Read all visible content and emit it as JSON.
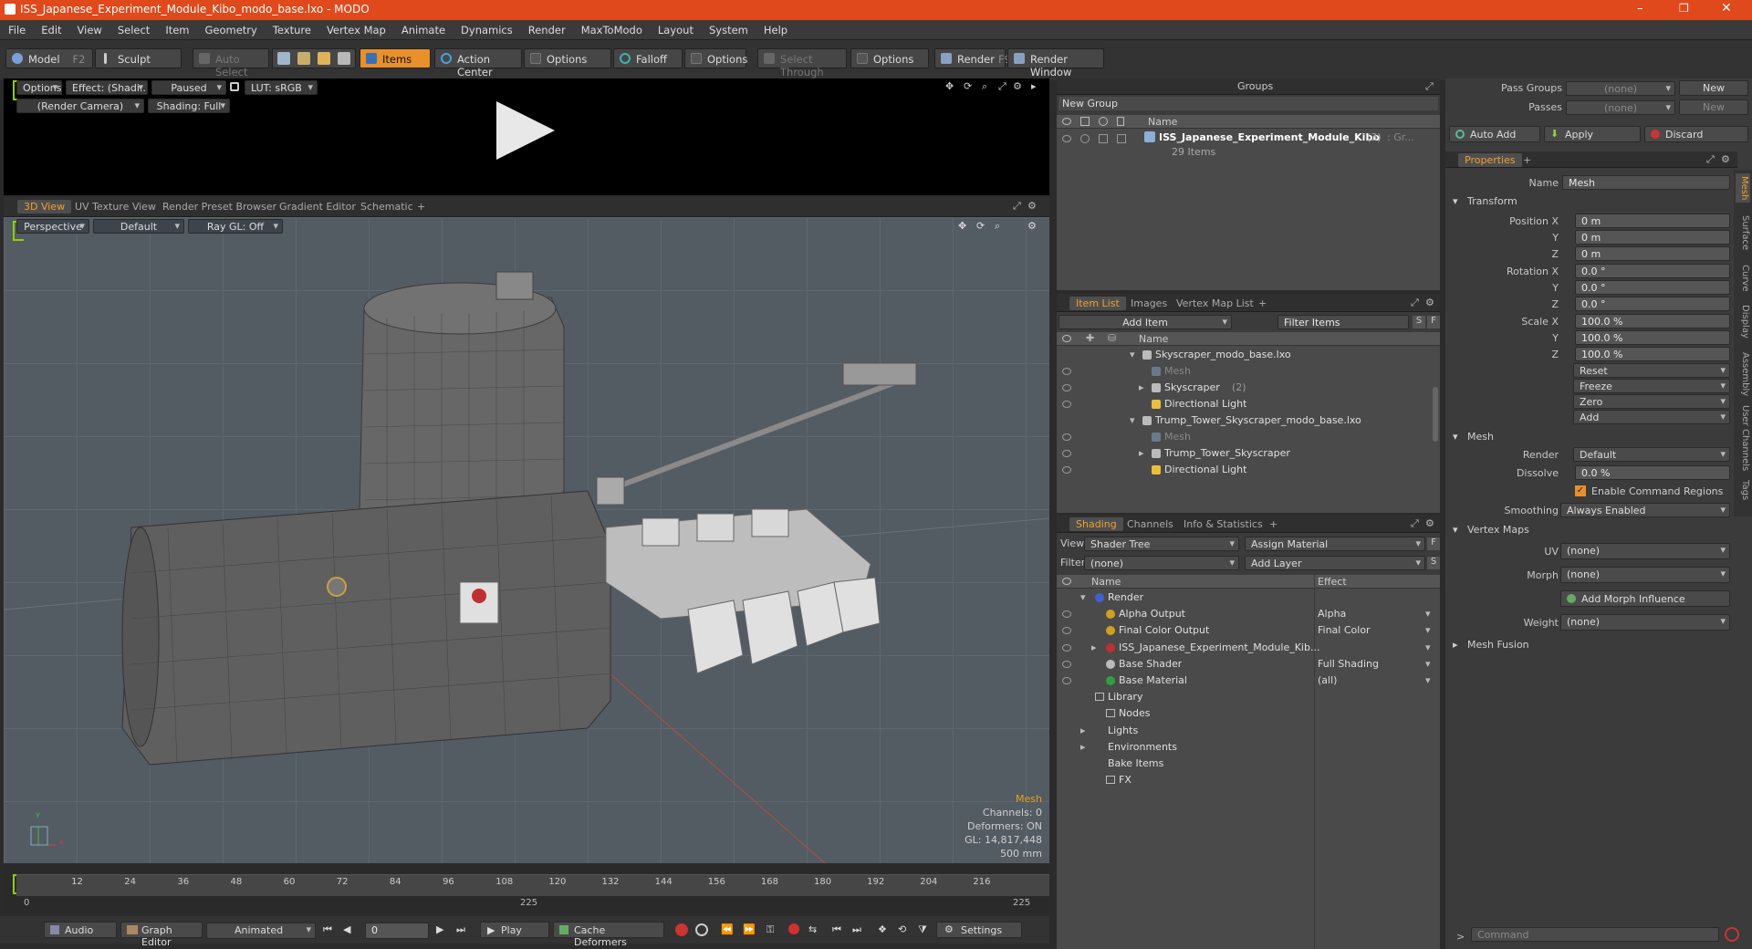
{
  "window": {
    "title": "ISS_Japanese_Experiment_Module_Kibo_modo_base.lxo - MODO"
  },
  "menu": [
    "File",
    "Edit",
    "View",
    "Select",
    "Item",
    "Geometry",
    "Texture",
    "Vertex Map",
    "Animate",
    "Dynamics",
    "Render",
    "MaxToModo",
    "Layout",
    "System",
    "Help"
  ],
  "toolbar": {
    "model": "Model",
    "model_key": "F2",
    "sculpt": "Sculpt",
    "auto_select": "Auto Select",
    "items": "Items",
    "action_center": "Action Center",
    "options1": "Options",
    "falloff": "Falloff",
    "options2": "Options",
    "select_through": "Select Through",
    "options3": "Options",
    "render": "Render",
    "render_key": "F9",
    "render_window": "Render Window"
  },
  "preview": {
    "options": "Options",
    "effect": "Effect: (Shadi...",
    "paused": "Paused",
    "lut": "LUT: sRGB",
    "camera": "(Render Camera)",
    "shading": "Shading: Full"
  },
  "viewport_tabs": [
    "3D View",
    "UV Texture View",
    "Render Preset Browser",
    "Gradient Editor",
    "Schematic"
  ],
  "viewport": {
    "perspective": "Perspective",
    "default": "Default",
    "raygl": "Ray GL: Off",
    "info": {
      "mesh": "Mesh",
      "channels": "Channels: 0",
      "deformers": "Deformers: ON",
      "gl": "GL: 14,817,448",
      "size": "500 mm"
    },
    "label_x": "x",
    "label_y": "y"
  },
  "timeline": {
    "ticks": [
      "0",
      "12",
      "24",
      "36",
      "48",
      "60",
      "72",
      "84",
      "96",
      "108",
      "120",
      "132",
      "144",
      "156",
      "168",
      "180",
      "192",
      "204",
      "216"
    ],
    "mid": "225",
    "end": "225",
    "start": "0"
  },
  "bottombar": {
    "audio": "Audio",
    "graph_editor": "Graph Editor",
    "animated": "Animated",
    "frame": "0",
    "play": "Play",
    "cache": "Cache Deformers",
    "settings": "Settings"
  },
  "groups": {
    "title": "Groups",
    "new_group": "New Group",
    "col_name": "Name",
    "item_name": "ISS_Japanese_Experiment_Module_Kibo",
    "item_count": "(3)",
    "item_suffix": ": Gr...",
    "item_sub": "29 Items"
  },
  "itemlist": {
    "tabs": [
      "Item List",
      "Images",
      "Vertex Map List"
    ],
    "add_item": "Add Item",
    "filter": "Filter Items",
    "col_name": "Name",
    "rows": [
      {
        "label": "Skyscraper_modo_base.lxo",
        "indent": 0,
        "arrow": "▾"
      },
      {
        "label": "Mesh",
        "indent": 1,
        "arrow": "",
        "dim": true
      },
      {
        "label": "Skyscraper",
        "indent": 1,
        "arrow": "▸",
        "count": "(2)"
      },
      {
        "label": "Directional Light",
        "indent": 1,
        "arrow": ""
      },
      {
        "label": "Trump_Tower_Skyscraper_modo_base.lxo",
        "indent": 0,
        "arrow": "▾"
      },
      {
        "label": "Mesh",
        "indent": 1,
        "arrow": "",
        "dim": true
      },
      {
        "label": "Trump_Tower_Skyscraper",
        "indent": 1,
        "arrow": "▸"
      },
      {
        "label": "Directional Light",
        "indent": 1,
        "arrow": ""
      }
    ]
  },
  "shading": {
    "tabs": [
      "Shading",
      "Channels",
      "Info & Statistics"
    ],
    "view_label": "View",
    "view_value": "Shader Tree",
    "assign": "Assign Material",
    "filter_label": "Filter",
    "filter_value": "(none)",
    "add_layer": "Add Layer",
    "col_name": "Name",
    "col_effect": "Effect",
    "rows": [
      {
        "label": "Render",
        "effect": "",
        "indent": 0,
        "arrow": "▾",
        "color": "#4060d0"
      },
      {
        "label": "Alpha Output",
        "effect": "Alpha",
        "indent": 1,
        "arrow": "",
        "color": "#d0a020"
      },
      {
        "label": "Final Color Output",
        "effect": "Final Color",
        "indent": 1,
        "arrow": "",
        "color": "#d0a020"
      },
      {
        "label": "ISS_Japanese_Experiment_Module_Kib...",
        "effect": "",
        "indent": 1,
        "arrow": "▸",
        "color": "#c03030"
      },
      {
        "label": "Base Shader",
        "effect": "Full Shading",
        "indent": 1,
        "arrow": "",
        "color": "#bbbbbb"
      },
      {
        "label": "Base Material",
        "effect": "(all)",
        "indent": 1,
        "arrow": "",
        "color": "#30a040"
      },
      {
        "label": "Library",
        "effect": "",
        "indent": 0,
        "arrow": "",
        "color": ""
      },
      {
        "label": "Nodes",
        "effect": "",
        "indent": 1,
        "arrow": "",
        "color": ""
      },
      {
        "label": "Lights",
        "effect": "",
        "indent": 0,
        "arrow": "▸",
        "color": ""
      },
      {
        "label": "Environments",
        "effect": "",
        "indent": 0,
        "arrow": "▸",
        "color": ""
      },
      {
        "label": "Bake Items",
        "effect": "",
        "indent": 0,
        "arrow": "",
        "color": ""
      },
      {
        "label": "FX",
        "effect": "",
        "indent": 1,
        "arrow": "",
        "color": ""
      }
    ]
  },
  "right": {
    "pass_groups_label": "Pass Groups",
    "pass_groups_value": "(none)",
    "new1": "New",
    "passes_label": "Passes",
    "passes_value": "(none)",
    "new2": "New",
    "auto_add": "Auto Add",
    "apply": "Apply",
    "discard": "Discard",
    "properties_tab": "Properties",
    "name_label": "Name",
    "name_value": "Mesh",
    "transform": "Transform",
    "pos_x_label": "Position X",
    "pos_x": "0 m",
    "y1": "Y",
    "pos_y": "0 m",
    "z1": "Z",
    "pos_z": "0 m",
    "rot_x_label": "Rotation X",
    "rot_x": "0.0 °",
    "y2": "Y",
    "rot_y": "0.0 °",
    "z2": "Z",
    "rot_z": "0.0 °",
    "scl_x_label": "Scale X",
    "scl_x": "100.0 %",
    "y3": "Y",
    "scl_y": "100.0 %",
    "z3": "Z",
    "scl_z": "100.0 %",
    "reset": "Reset",
    "freeze": "Freeze",
    "zero": "Zero",
    "add": "Add",
    "mesh_section": "Mesh",
    "render_label": "Render",
    "render_value": "Default",
    "dissolve_label": "Dissolve",
    "dissolve_value": "0.0 %",
    "cmd_regions": "Enable Command Regions",
    "smoothing_label": "Smoothing",
    "smoothing_value": "Always Enabled",
    "vertex_maps": "Vertex Maps",
    "uv_label": "UV",
    "uv_value": "(none)",
    "morph_label": "Morph",
    "morph_value": "(none)",
    "add_morph": "Add Morph Influence",
    "weight_label": "Weight",
    "weight_value": "(none)",
    "mesh_fusion": "Mesh Fusion",
    "side_tabs": [
      "Mesh",
      "Surface",
      "Curve",
      "Display",
      "Assembly",
      "User Channels",
      "Tags"
    ],
    "command": "Command"
  },
  "colors": {
    "accent": "#e8902a",
    "titlebar": "#e0491b"
  }
}
